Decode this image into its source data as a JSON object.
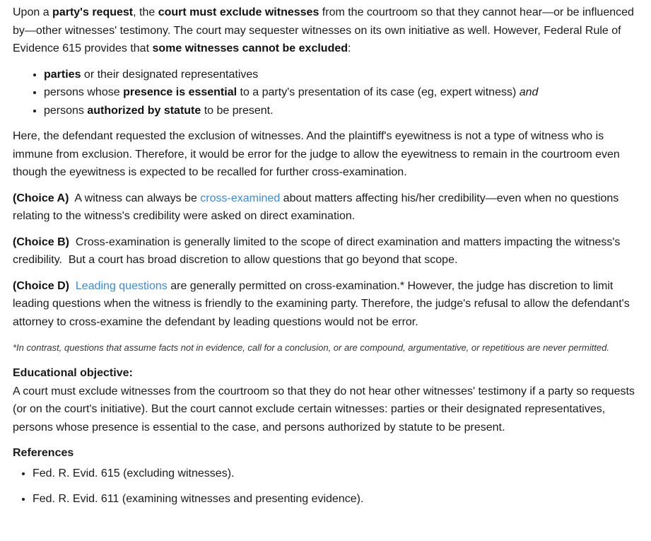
{
  "intro": {
    "t1": "Upon a ",
    "b1": "party's request",
    "t2": ", the ",
    "b2": "court must exclude witnesses",
    "t3": " from the courtroom so that they cannot hear—or be influenced by—other witnesses' testimony.  The court may sequester witnesses on its own initiative as well.  However, Federal Rule of Evidence 615 provides that ",
    "b3": "some witnesses cannot be excluded",
    "t4": ":"
  },
  "bullets": [
    {
      "bold": "parties",
      "text": " or their designated representatives"
    },
    {
      "pre": "persons whose ",
      "bold": "presence is essential",
      "text": " to a party's presentation of its case (eg, expert witness) ",
      "ital": "and"
    },
    {
      "pre": "persons ",
      "bold": "authorized by statute",
      "text": " to be present."
    }
  ],
  "analysis": "Here, the defendant requested the exclusion of witnesses.  And the plaintiff's eyewitness is not a type of witness who is immune from exclusion.  Therefore, it would be error for the judge to allow the eyewitness to remain in the courtroom even though the eyewitness is expected to be recalled for further cross-examination.",
  "choices": {
    "a": {
      "label": "(Choice A)",
      "pre": "  A witness can always be ",
      "link": "cross-examined",
      "post": " about matters affecting his/her credibility—even when no questions relating to the witness's credibility were asked on direct examination."
    },
    "b": {
      "label": "(Choice B)",
      "text": "  Cross-examination is generally limited to the scope of direct examination and matters impacting the witness's credibility.  But a court has broad discretion to allow questions that go beyond that scope."
    },
    "d": {
      "label": "(Choice D)",
      "pre": "  ",
      "link": "Leading questions",
      "post": " are generally permitted on cross-examination.*  However, the judge has discretion to limit leading questions when the witness is friendly to the examining party.  Therefore, the judge's refusal to allow the defendant's attorney to cross-examine the defendant by leading questions would not be error."
    }
  },
  "footnote": "*In contrast, questions that assume facts not in evidence, call for a conclusion, or are compound, argumentative, or repetitious are never permitted.",
  "objective": {
    "heading": "Educational objective:",
    "text": "A court must exclude witnesses from the courtroom so that they do not hear other witnesses' testimony if a party so requests (or on the court's initiative).  But the court cannot exclude certain witnesses: parties or their designated representatives, persons whose presence is essential to the case, and persons authorized by statute to be present."
  },
  "references": {
    "heading": "References",
    "items": [
      "Fed. R. Evid. 615 (excluding witnesses).",
      "Fed. R. Evid. 611 (examining witnesses and presenting evidence)."
    ]
  }
}
